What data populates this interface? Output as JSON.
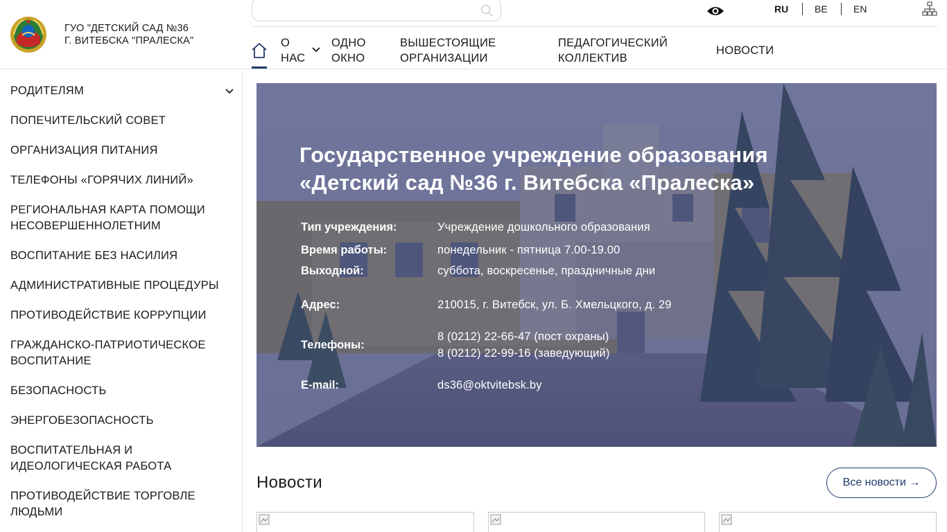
{
  "header": {
    "org_name_line1": "ГУО \"ДЕТСКИЙ САД №36",
    "org_name_line2": "Г. ВИТЕБСКА \"ПРАЛЕСКА\"",
    "search_value": "",
    "languages": [
      "RU",
      "BE",
      "EN"
    ],
    "active_language": "RU"
  },
  "nav": {
    "items": [
      {
        "lines": [
          "О",
          "НАС"
        ],
        "has_dropdown": true
      },
      {
        "lines": [
          "ОДНО",
          "ОКНО"
        ]
      },
      {
        "lines": [
          "ВЫШЕСТОЯЩИЕ",
          "ОРГАНИЗАЦИИ"
        ]
      },
      {
        "lines": [
          "ПЕДАГОГИЧЕСКИЙ",
          "КОЛЛЕКТИВ"
        ]
      },
      {
        "lines": [
          "НОВОСТИ"
        ]
      }
    ]
  },
  "sidebar": {
    "items": [
      {
        "lines": [
          "РОДИТЕЛЯМ"
        ],
        "has_dropdown": true
      },
      {
        "lines": [
          "ПОПЕЧИТЕЛЬСКИЙ СОВЕТ"
        ]
      },
      {
        "lines": [
          "ОРГАНИЗАЦИЯ ПИТАНИЯ"
        ]
      },
      {
        "lines": [
          "ТЕЛЕФОНЫ «ГОРЯЧИХ ЛИНИЙ»"
        ]
      },
      {
        "lines": [
          "РЕГИОНАЛЬНАЯ КАРТА ПОМОЩИ",
          "НЕСОВЕРШЕННОЛЕТНИМ"
        ]
      },
      {
        "lines": [
          "ВОСПИТАНИЕ БЕЗ НАСИЛИЯ"
        ]
      },
      {
        "lines": [
          "АДМИНИСТРАТИВНЫЕ ПРОЦЕДУРЫ"
        ]
      },
      {
        "lines": [
          "ПРОТИВОДЕЙСТВИЕ КОРРУПЦИИ"
        ]
      },
      {
        "lines": [
          "ГРАЖДАНСКО-ПАТРИОТИЧЕСКОЕ",
          "ВОСПИТАНИЕ"
        ]
      },
      {
        "lines": [
          "БЕЗОПАСНОСТЬ"
        ]
      },
      {
        "lines": [
          "ЭНЕРГОБЕЗОПАСНОСТЬ"
        ]
      },
      {
        "lines": [
          "ВОСПИТАТЕЛЬНАЯ И",
          "ИДЕОЛОГИЧЕСКАЯ РАБОТА"
        ]
      },
      {
        "lines": [
          "ПРОТИВОДЕЙСТВИЕ ТОРГОВЛЕ",
          "ЛЮДЬМИ"
        ]
      }
    ]
  },
  "hero": {
    "title_line1": "Государственное учреждение образования",
    "title_line2": "«Детский сад №36 г. Витебска «Пралеска»",
    "info": [
      {
        "label": "Тип учреждения:",
        "value": "Учреждение дошкольного образования"
      },
      {
        "label": "Время работы:",
        "value": "понедельник - пятница 7.00-19.00"
      },
      {
        "label": "Выходной:",
        "value": "суббота, воскресенье, праздничные дни"
      },
      {
        "label": "Адрес:",
        "value": "210015, г. Витебск, ул. Б. Хмельцкого, д. 29"
      },
      {
        "label": "Телефоны:",
        "value_lines": [
          "8 (0212) 22-66-47 (пост охраны)",
          "8 (0212) 22-99-16 (заведующий)"
        ]
      },
      {
        "label": "E-mail:",
        "value": "ds36@oktvitebsk.by"
      }
    ]
  },
  "news": {
    "heading": "Новости",
    "all_news_label": "Все новости →"
  },
  "colors": {
    "accent": "#1f3a6b",
    "hero_overlay": "#3a4078",
    "border": "#e3e3e3"
  }
}
